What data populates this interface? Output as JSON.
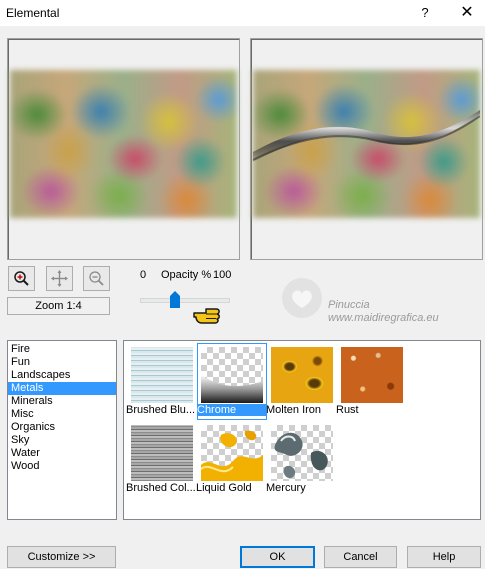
{
  "window": {
    "title": "Elemental",
    "help_label": "?",
    "close_label": "✕"
  },
  "toolbar": {
    "zoom_text": "Zoom 1:4"
  },
  "opacity": {
    "min": "0",
    "label": "Opacity %",
    "max": "100",
    "value_fraction": 0.4
  },
  "watermark": {
    "name": "Pinuccia",
    "url": "www.maidiregrafica.eu"
  },
  "categories": {
    "items": [
      "Fire",
      "Fun",
      "Landscapes",
      "Metals",
      "Minerals",
      "Misc",
      "Organics",
      "Sky",
      "Water",
      "Wood"
    ],
    "selected": "Metals"
  },
  "presets": {
    "items": [
      "Brushed Blu...",
      "Chrome",
      "Molten Iron",
      "Rust",
      "Brushed Col...",
      "Liquid Gold",
      "Mercury"
    ],
    "selected": "Chrome"
  },
  "buttons": {
    "customize": "Customize   >>",
    "ok": "OK",
    "cancel": "Cancel",
    "help": "Help"
  },
  "colors": {
    "selection": "#3399ff",
    "ok_border": "#0078d7"
  }
}
